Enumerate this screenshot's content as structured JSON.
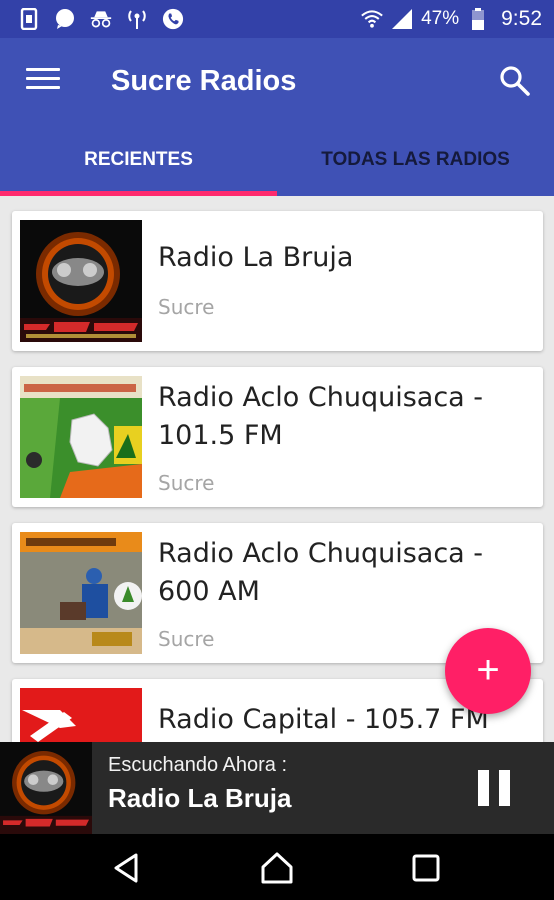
{
  "status_bar": {
    "battery": "47%",
    "time": "9:52",
    "icons": [
      "sim-icon",
      "message-icon",
      "incognito-icon",
      "hotspot-icon",
      "phone-icon",
      "wifi-icon",
      "signal-icon",
      "battery-icon"
    ]
  },
  "app_bar": {
    "title": "Sucre Radios",
    "menu_icon": "hamburger-menu-icon",
    "search_icon": "search-icon"
  },
  "tabs": [
    {
      "label": "RECIENTES",
      "active": true
    },
    {
      "label": "TODAS LAS RADIOS",
      "active": false
    }
  ],
  "stations": [
    {
      "name": "Radio La Bruja",
      "city": "Sucre"
    },
    {
      "name": "Radio Aclo Chuquisaca - 101.5 FM",
      "city": "Sucre"
    },
    {
      "name": "Radio Aclo Chuquisaca - 600 AM",
      "city": "Sucre"
    },
    {
      "name": "Radio Capital - 105.7 FM",
      "city": ""
    }
  ],
  "fab": {
    "label": "+"
  },
  "player": {
    "label": "Escuchando Ahora :",
    "station": "Radio La Bruja"
  },
  "nav": {
    "back_icon": "back-icon",
    "home_icon": "home-icon",
    "recents_icon": "recents-icon"
  },
  "colors": {
    "primary": "#3f51b5",
    "primary_dark": "#3341a8",
    "accent": "#ff1f66",
    "tab_indicator": "#ff2b6e"
  }
}
